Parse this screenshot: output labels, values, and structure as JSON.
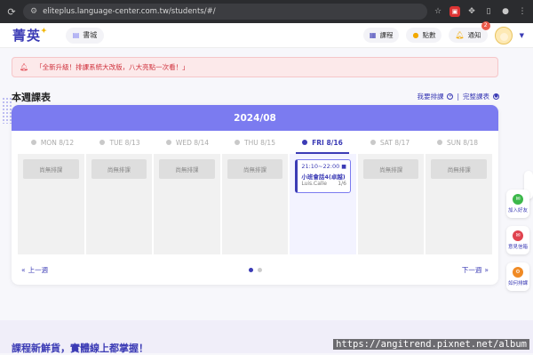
{
  "browser": {
    "url": "eliteplus.language-center.com.tw/students/#/"
  },
  "header": {
    "logo": "菁英",
    "shop_label": "書城",
    "schedule_label": "課程",
    "points_label": "點數",
    "notify_label": "通知",
    "notify_count": "2"
  },
  "notice": {
    "text": "「全新升級！排課系統大改版，八大亮點一次看！」"
  },
  "week": {
    "title": "本週課表",
    "my_schedule_link": "我要排課",
    "full_schedule_link": "完整課表",
    "separator": "|",
    "month": "2024/08",
    "days": [
      {
        "label": "MON 8/12",
        "active": false
      },
      {
        "label": "TUE 8/13",
        "active": false
      },
      {
        "label": "WED 8/14",
        "active": false
      },
      {
        "label": "THU 8/15",
        "active": false
      },
      {
        "label": "FRI 8/16",
        "active": true
      },
      {
        "label": "SAT 8/17",
        "active": false
      },
      {
        "label": "SUN 8/18",
        "active": false
      }
    ],
    "empty_label": "尚無排課",
    "lesson": {
      "time": "21:10~22:00",
      "name": "小班會話4(卓越)",
      "teacher": "Luis.Calle",
      "count": "1/6"
    },
    "prev_label": "上一週",
    "next_label": "下一週"
  },
  "side": {
    "add_friend": "加入好友",
    "feedback": "意見信箱",
    "how_to": "如何排課"
  },
  "bottom": {
    "banner_text": "課程新鮮貨，實體線上都掌握！",
    "watermark": "https://angitrend.pixnet.net/album"
  },
  "colors": {
    "brand": "#3b3bb5",
    "header_band": "#7b7bf0",
    "notice_text": "#d0333e"
  }
}
